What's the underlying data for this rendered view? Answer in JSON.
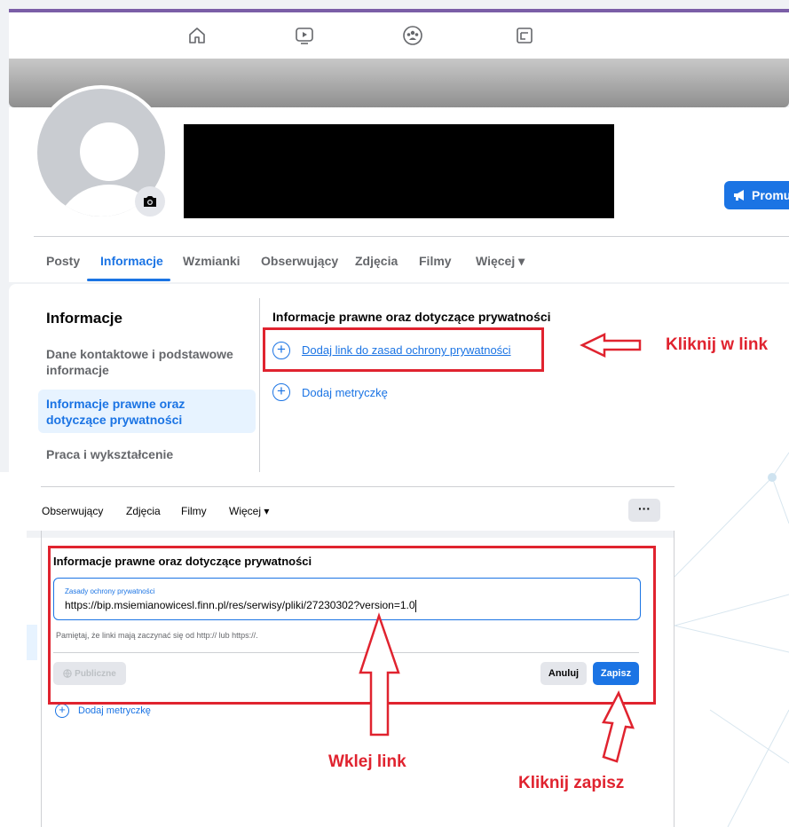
{
  "top": {
    "nav_icons": [
      "home-icon",
      "video-icon",
      "groups-icon",
      "pages-icon"
    ],
    "promote_label": "Promuj",
    "tabs": [
      "Posty",
      "Informacje",
      "Wzmianki",
      "Obserwujący",
      "Zdjęcia",
      "Filmy",
      "Więcej ▾"
    ],
    "about": {
      "title": "Informacje",
      "sidebar": [
        "Dane kontaktowe i podstawowe informacje",
        "Informacje prawne oraz dotyczące prywatności",
        "Praca i wykształcenie"
      ],
      "section_title": "Informacje prawne oraz dotyczące prywatności",
      "add_privacy_link": "Dodaj link do zasad ochrony prywatności",
      "add_imprint": "Dodaj metryczkę"
    },
    "annotation": "Kliknij w link"
  },
  "bottom": {
    "tabs": [
      "Obserwujący",
      "Zdjęcia",
      "Filmy",
      "Więcej ▾"
    ],
    "more_label": "···",
    "section_title": "Informacje prawne oraz dotyczące prywatności",
    "field_label": "Zasady ochrony prywatności",
    "field_value": "https://bip.msiemianowicesl.finn.pl/res/serwisy/pliki/27230302?version=1.0",
    "hint": "Pamiętaj, że linki mają zaczynać się od http:// lub https://.",
    "public_label": "Publiczne",
    "cancel_label": "Anuluj",
    "save_label": "Zapisz",
    "add_imprint": "Dodaj metryczkę",
    "annotation_paste": "Wklej link",
    "annotation_save": "Kliknij zapisz"
  },
  "colors": {
    "accent": "#1b74e4",
    "annotation": "#e0232f",
    "header_strip": "#7b5ea7"
  }
}
